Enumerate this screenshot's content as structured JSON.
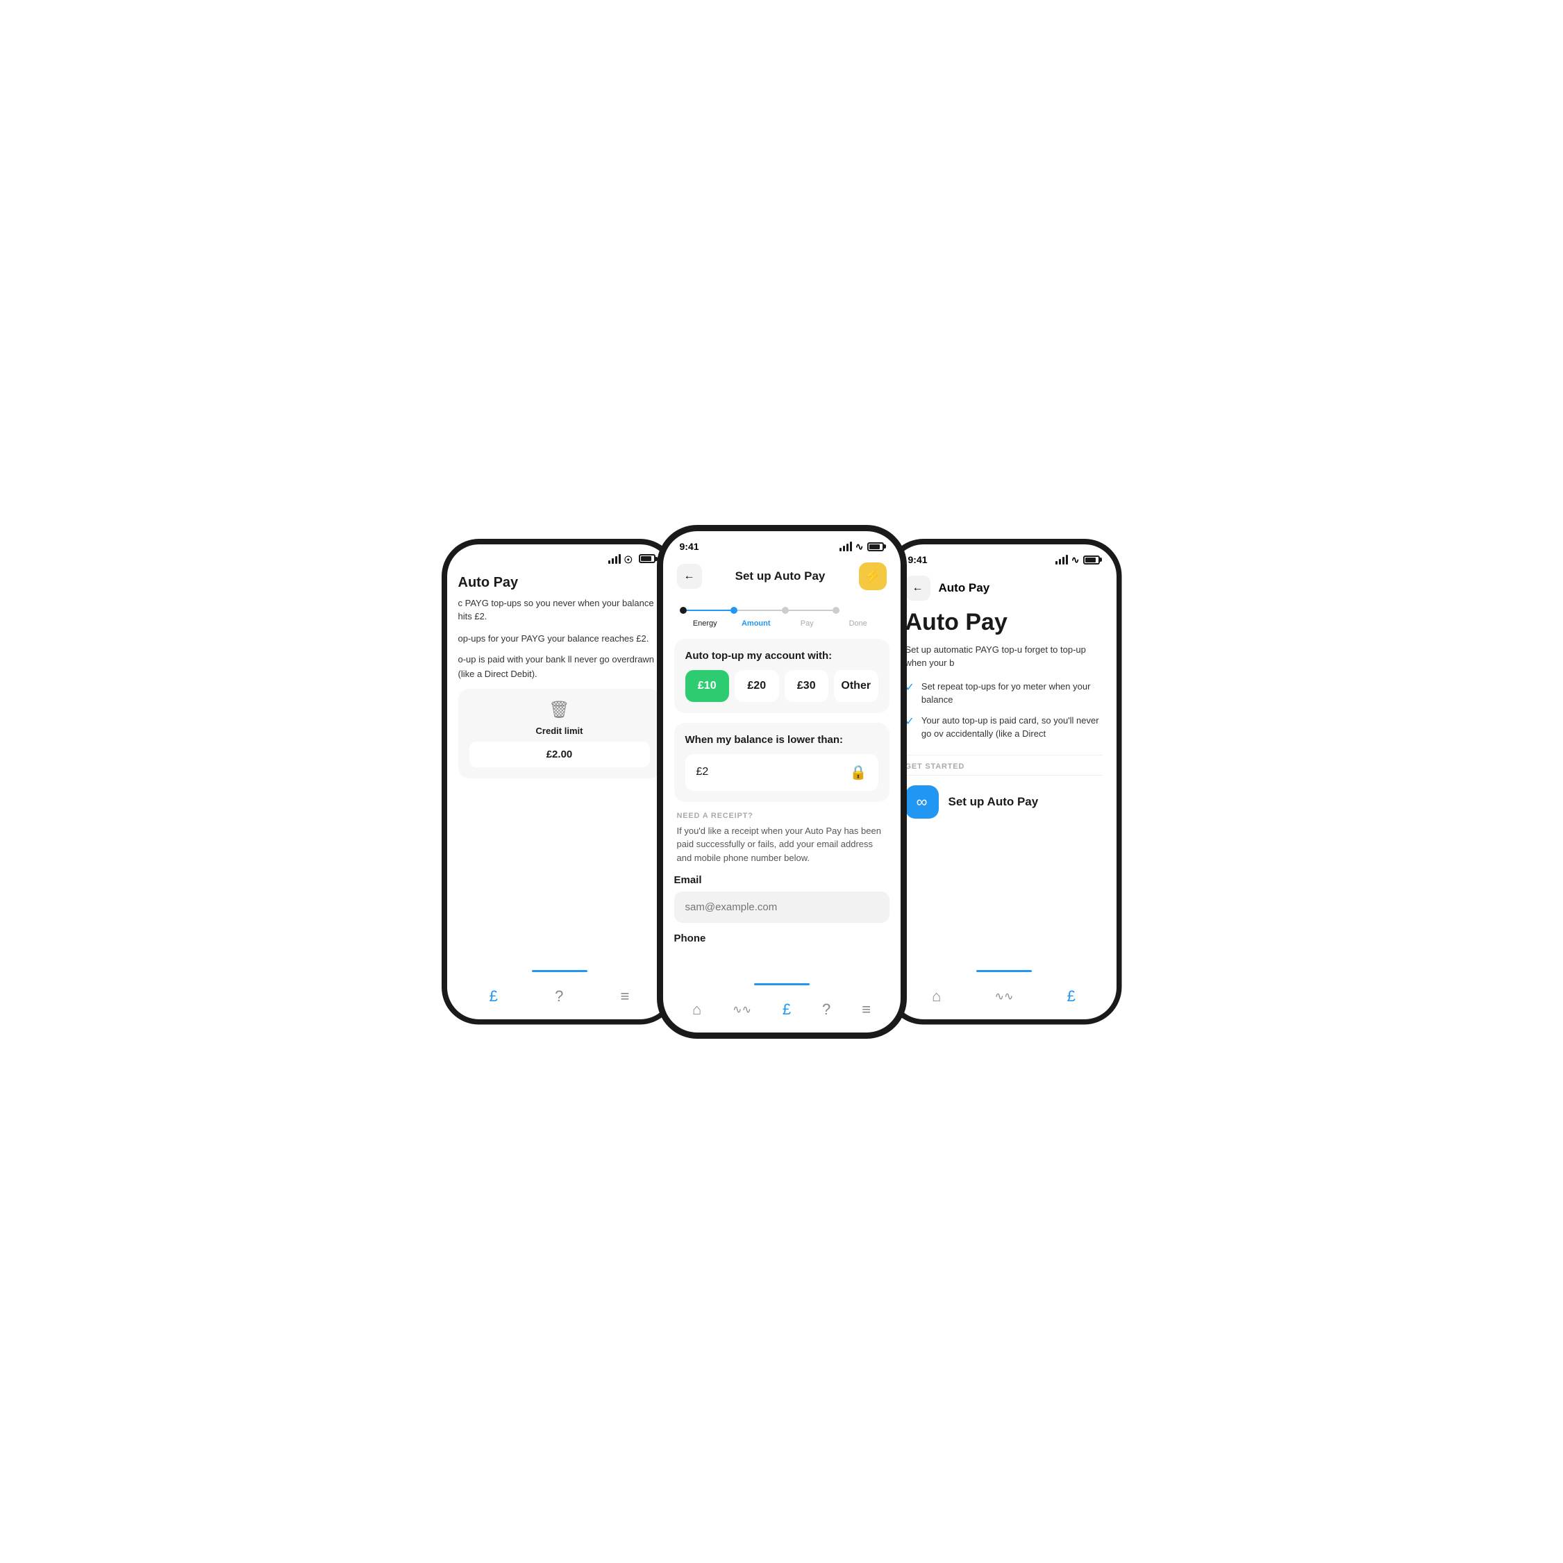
{
  "left_phone": {
    "nav_title": "Auto Pay",
    "desc1": "c PAYG top-ups so you never when your balance hits £2.",
    "desc2": "op-ups for your PAYG your balance reaches £2.",
    "desc3": "o-up is paid with your bank ll never go overdrawn (like a Direct Debit).",
    "credit_label": "Credit limit",
    "credit_value": "£2.00",
    "tab_icons": [
      "£",
      "?",
      "≡"
    ]
  },
  "center_phone": {
    "status_time": "9:41",
    "nav_title": "Set up Auto Pay",
    "stepper": {
      "steps": [
        "Energy",
        "Amount",
        "Pay",
        "Done"
      ],
      "active_index": 1
    },
    "amount_card": {
      "title": "Auto top-up my account with:",
      "options": [
        "£10",
        "£20",
        "£30",
        "Other"
      ],
      "selected": 0
    },
    "balance_card": {
      "title": "When my balance is lower than:",
      "value": "£2"
    },
    "receipt": {
      "label": "NEED A RECEIPT?",
      "desc": "If you'd like a receipt when your Auto Pay has been paid successfully or fails, add your email address and mobile phone number below."
    },
    "email_field": {
      "label": "Email",
      "placeholder": "sam@example.com"
    },
    "phone_field": {
      "label": "Phone",
      "placeholder": ""
    },
    "tab_icons": [
      "⌂",
      "∿∿",
      "£",
      "?",
      "≡"
    ]
  },
  "right_phone": {
    "status_time": "9:41",
    "nav_title": "Auto Pay",
    "big_title": "Auto Pay",
    "desc": "Set up automatic PAYG top-u forget to top-up when your b",
    "checks": [
      "Set repeat top-ups for yo meter when your balance",
      "Your auto top-up is paid card, so you'll never go ov accidentally (like a Direct"
    ],
    "get_started_label": "GET STARTED",
    "setup_btn_label": "Set up Auto Pay",
    "tab_icons": [
      "⌂",
      "∿∿",
      "£"
    ]
  },
  "icons": {
    "back_arrow": "←",
    "lightning": "⚡",
    "lock": "🔒",
    "trash": "🗑",
    "infinity": "∞",
    "check": "✓"
  }
}
